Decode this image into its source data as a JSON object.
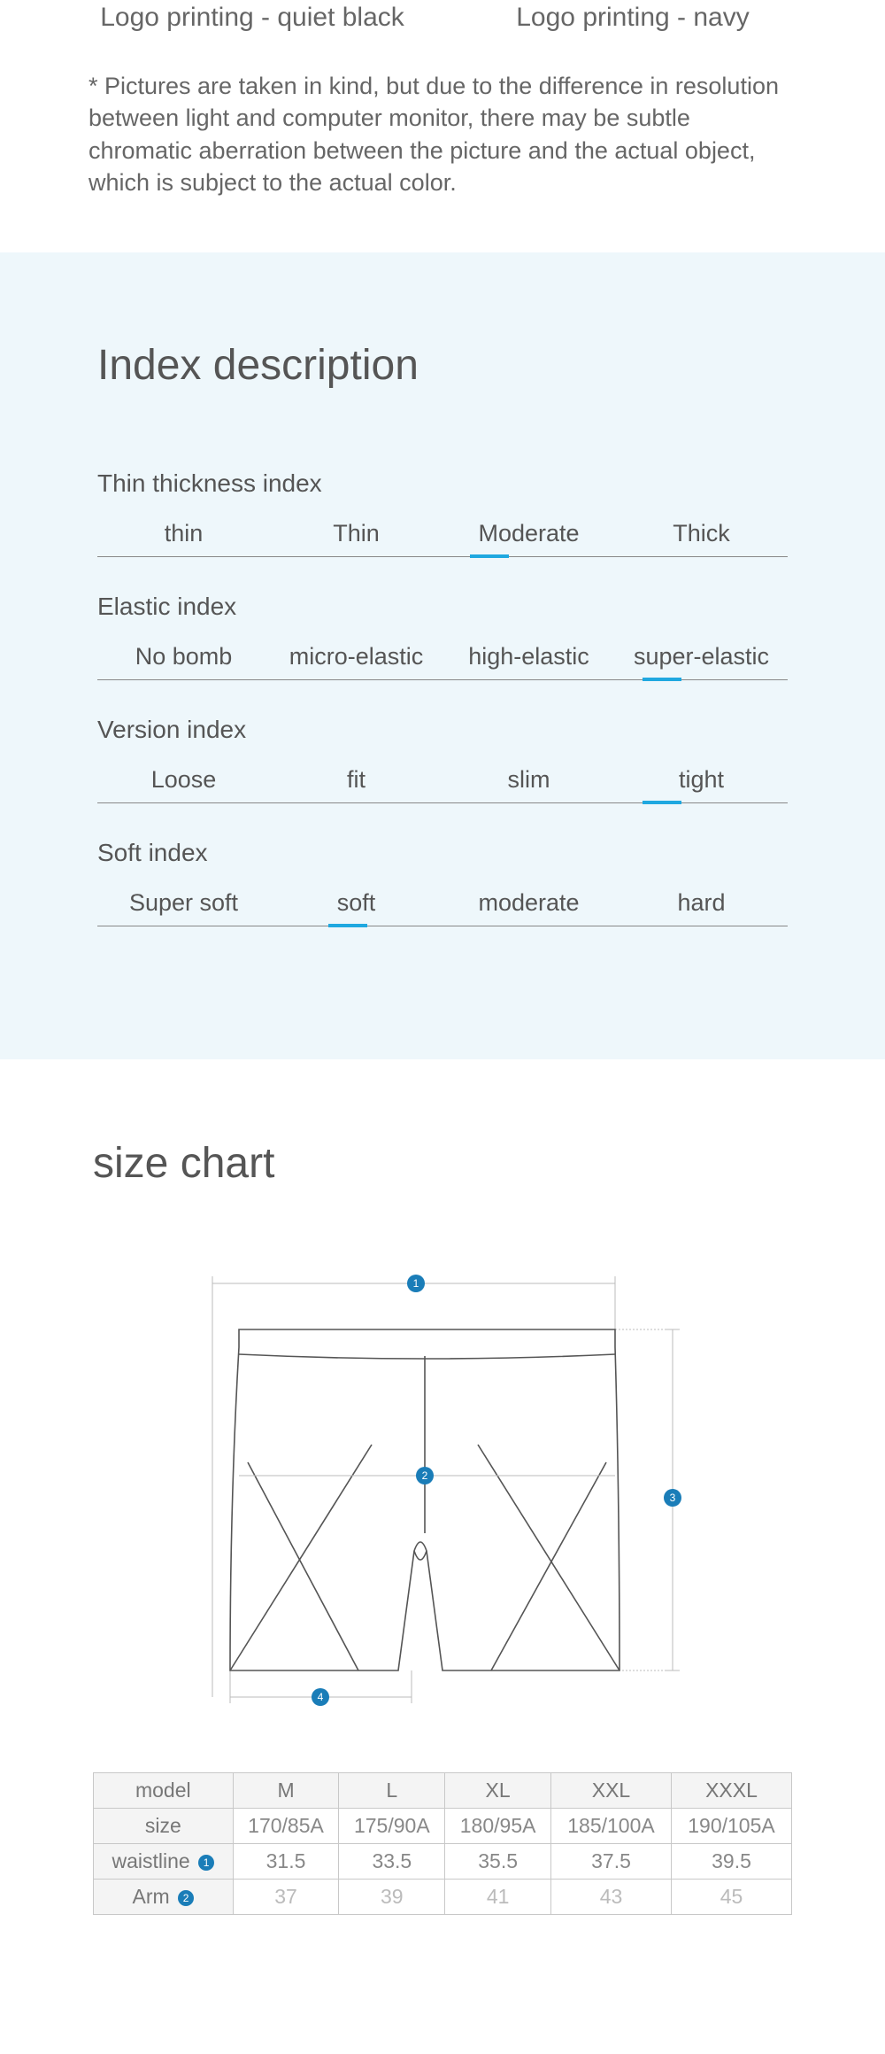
{
  "topLabels": {
    "left": "Logo printing - quiet black",
    "right": "Logo printing - navy"
  },
  "disclaimer": "* Pictures are taken in kind, but due to the difference in resolution between light and computer monitor, there may be subtle chromatic aberration between the picture and the actual object, which is subject to the actual color.",
  "indexTitle": "Index description",
  "indices": [
    {
      "label": "Thin thickness index",
      "options": [
        "thin",
        "Thin",
        "Moderate",
        "Thick"
      ],
      "selected": 2,
      "markerOffset": -45
    },
    {
      "label": "Elastic index",
      "options": [
        "No bomb",
        "micro-elastic",
        "high-elastic",
        "super-elastic"
      ],
      "selected": 3,
      "markerOffset": -45
    },
    {
      "label": "Version index",
      "options": [
        "Loose",
        "fit",
        "slim",
        "tight"
      ],
      "selected": 3,
      "markerOffset": -45
    },
    {
      "label": "Soft index",
      "options": [
        "Super soft",
        "soft",
        "moderate",
        "hard"
      ],
      "selected": 1,
      "markerOffset": -10
    }
  ],
  "sizeTitle": "size chart",
  "diagramBadges": [
    "1",
    "2",
    "3",
    "4"
  ],
  "sizeTable": {
    "headers": [
      "model",
      "M",
      "L",
      "XL",
      "XXL",
      "XXXL"
    ],
    "rows": [
      {
        "label": "size",
        "values": [
          "170/85A",
          "175/90A",
          "180/95A",
          "185/100A",
          "190/105A"
        ]
      },
      {
        "label": "waistline",
        "badge": "1",
        "values": [
          "31.5",
          "33.5",
          "35.5",
          "37.5",
          "39.5"
        ]
      },
      {
        "label": "Arm",
        "badge": "2",
        "values": [
          "37",
          "39",
          "41",
          "43",
          "45"
        ],
        "partial": true
      }
    ]
  }
}
